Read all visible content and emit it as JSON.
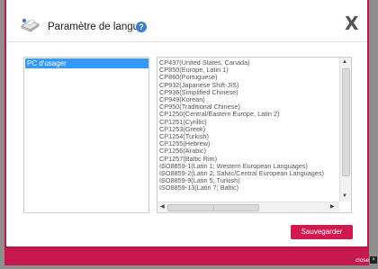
{
  "dialog": {
    "title": "Paramètre de langue",
    "help_icon": "?",
    "close_icon": "X",
    "save_label": "Sauvegarder"
  },
  "left_list": {
    "items": [
      "PC d'usager"
    ],
    "selected_index": 0
  },
  "encodings": {
    "items": [
      "CP437(United States, Canada)",
      "CP850(Europe, Latin 1)",
      "CP860(Portuguese)",
      "CP932(Japanese Shift-JIS)",
      "CP936(Simplified Chinese)",
      "CP949(Korean)",
      "CP950(Traditional Chinese)",
      "CP1250(Central/Eastern Europe, Latin 2)",
      "CP1251(Cyrillic)",
      "CP1253(Greek)",
      "CP1254(Turkish)",
      "CP1255(Hebrew)",
      "CP1256(Arabic)",
      "CP1257(Baltic Rim)",
      "ISO8859-1(Latin 1; Western European Languages)",
      "ISO8859-2(Latin 2; Salvic/Central European Languages)",
      "ISO8859-9(Latin 5; Turkish)",
      "ISO8859-13(Latin 7; Baltic)"
    ]
  },
  "footer": {
    "close_label": "close"
  },
  "colors": {
    "accent": "#c4184f",
    "selection": "#3399ff"
  },
  "icons": {
    "header": "printer-settings-icon",
    "help": "help-icon",
    "close": "close-icon"
  }
}
